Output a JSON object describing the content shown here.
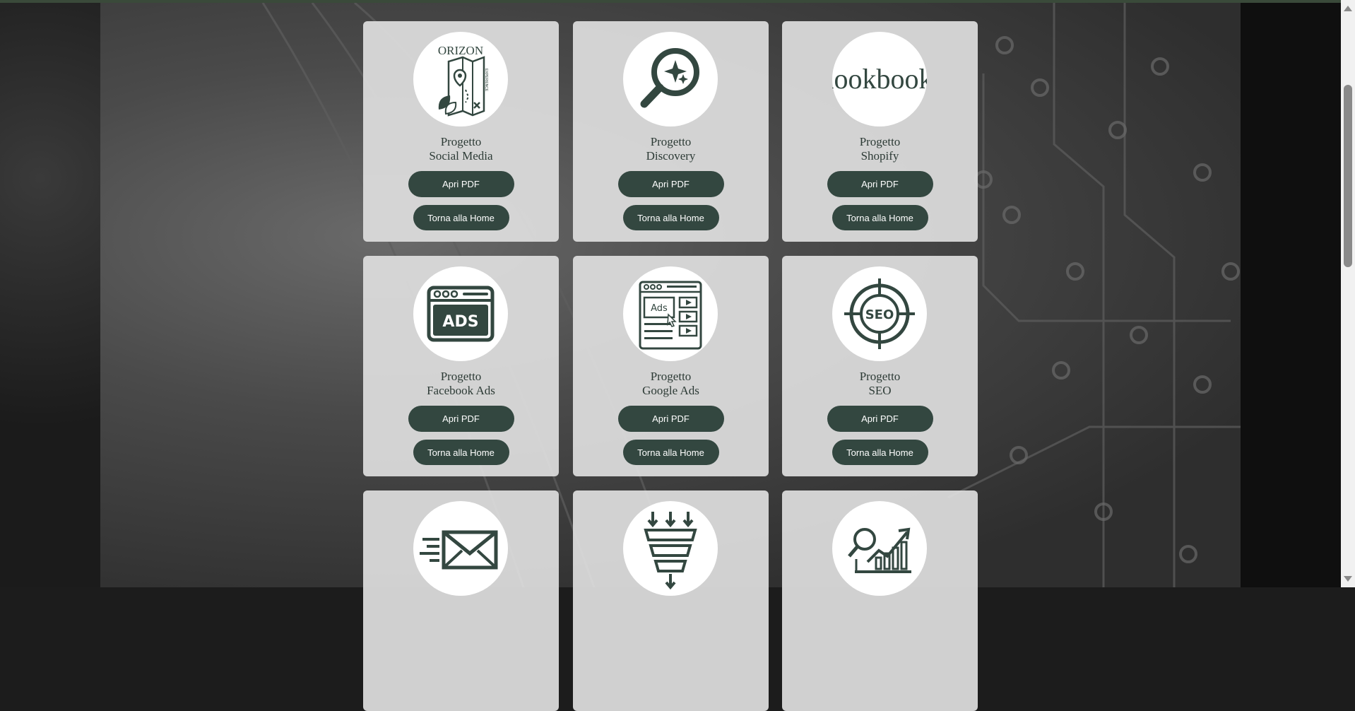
{
  "colors": {
    "card_bg": "#dedede",
    "button_bg": "#334740",
    "icon_color": "#334740",
    "title_color": "#2d3b36"
  },
  "cards": [
    {
      "title_line1": "Progetto",
      "title_line2": "Social Media",
      "icon": "orizon-logo-icon",
      "pdf_label": "Apri PDF",
      "home_label": "Torna alla Home"
    },
    {
      "title_line1": "Progetto",
      "title_line2": "Discovery",
      "icon": "magnifier-sparkle-icon",
      "pdf_label": "Apri PDF",
      "home_label": "Torna alla Home"
    },
    {
      "title_line1": "Progetto",
      "title_line2": "Shopify",
      "icon": "lookbook-logo-icon",
      "pdf_label": "Apri PDF",
      "home_label": "Torna alla Home"
    },
    {
      "title_line1": "Progetto",
      "title_line2": "Facebook Ads",
      "icon": "ads-window-icon",
      "pdf_label": "Apri PDF",
      "home_label": "Torna alla Home"
    },
    {
      "title_line1": "Progetto",
      "title_line2": "Google Ads",
      "icon": "google-ads-browser-icon",
      "pdf_label": "Apri PDF",
      "home_label": "Torna alla Home"
    },
    {
      "title_line1": "Progetto",
      "title_line2": "SEO",
      "icon": "seo-target-icon",
      "pdf_label": "Apri PDF",
      "home_label": "Torna alla Home"
    },
    {
      "icon": "email-envelope-icon"
    },
    {
      "icon": "funnel-icon"
    },
    {
      "icon": "analytics-chart-icon"
    }
  ],
  "logos": {
    "orizon_text": "ORIZON",
    "orizon_sub": "EXPERIENCE",
    "lookbook_text": "lookbook",
    "ads_text": "ADS",
    "google_ads_text": "Ads",
    "seo_text": "SEO"
  }
}
